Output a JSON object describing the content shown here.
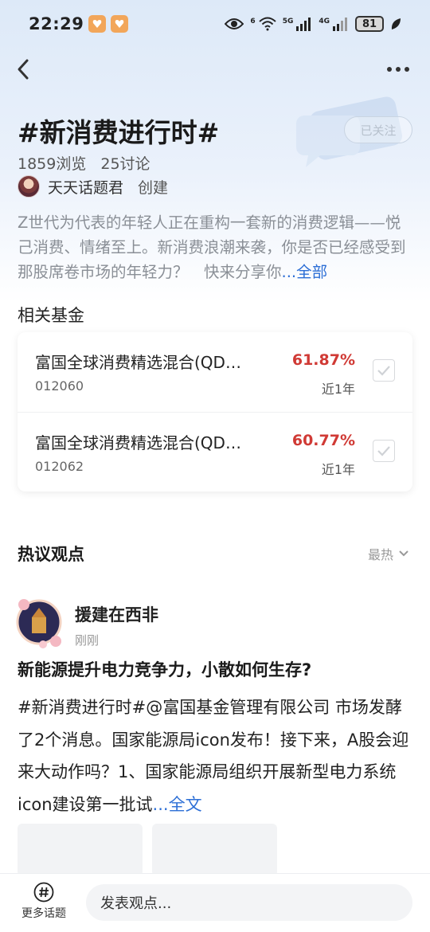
{
  "status_bar": {
    "time": "22:29",
    "network_label_1": "6",
    "network_label_2": "5G",
    "network_label_3": "4G",
    "battery": "81"
  },
  "topic": {
    "title": "#新消费进行时#",
    "follow_label": "已关注",
    "views": "1859浏览",
    "discussions": "25讨论",
    "creator_name": "天天话题君",
    "creator_action": "创建",
    "intro": "Z世代为代表的年轻人正在重构一套新的消费逻辑——悦己消费、情绪至上。新消费浪潮来袭，你是否已经感受到那股席卷市场的年轻力？　快来分享你",
    "intro_more": "...全部"
  },
  "related_funds": {
    "title": "相关基金",
    "items": [
      {
        "name": "富国全球消费精选混合(QD…",
        "code": "012060",
        "return": "61.87%",
        "period": "近1年"
      },
      {
        "name": "富国全球消费精选混合(QD…",
        "code": "012062",
        "return": "60.77%",
        "period": "近1年"
      }
    ]
  },
  "hot_opinions": {
    "title": "热议观点",
    "sort_label": "最热"
  },
  "post": {
    "author": "援建在西非",
    "time": "刚刚",
    "title": "新能源提升电力竞争力，小散如何生存?",
    "body": " #新消费进行时#@富国基金管理有限公司  市场发酵了2个消息。国家能源局icon发布！接下来，A股会迎来大动作吗？1、国家能源局组织开展新型电力系统icon建设第一批试",
    "more": "...全文"
  },
  "bottom_bar": {
    "more_topics_label": "更多话题",
    "input_placeholder": "发表观点..."
  },
  "colors": {
    "accent_blue": "#2d6fd6",
    "return_red": "#d03a35"
  }
}
